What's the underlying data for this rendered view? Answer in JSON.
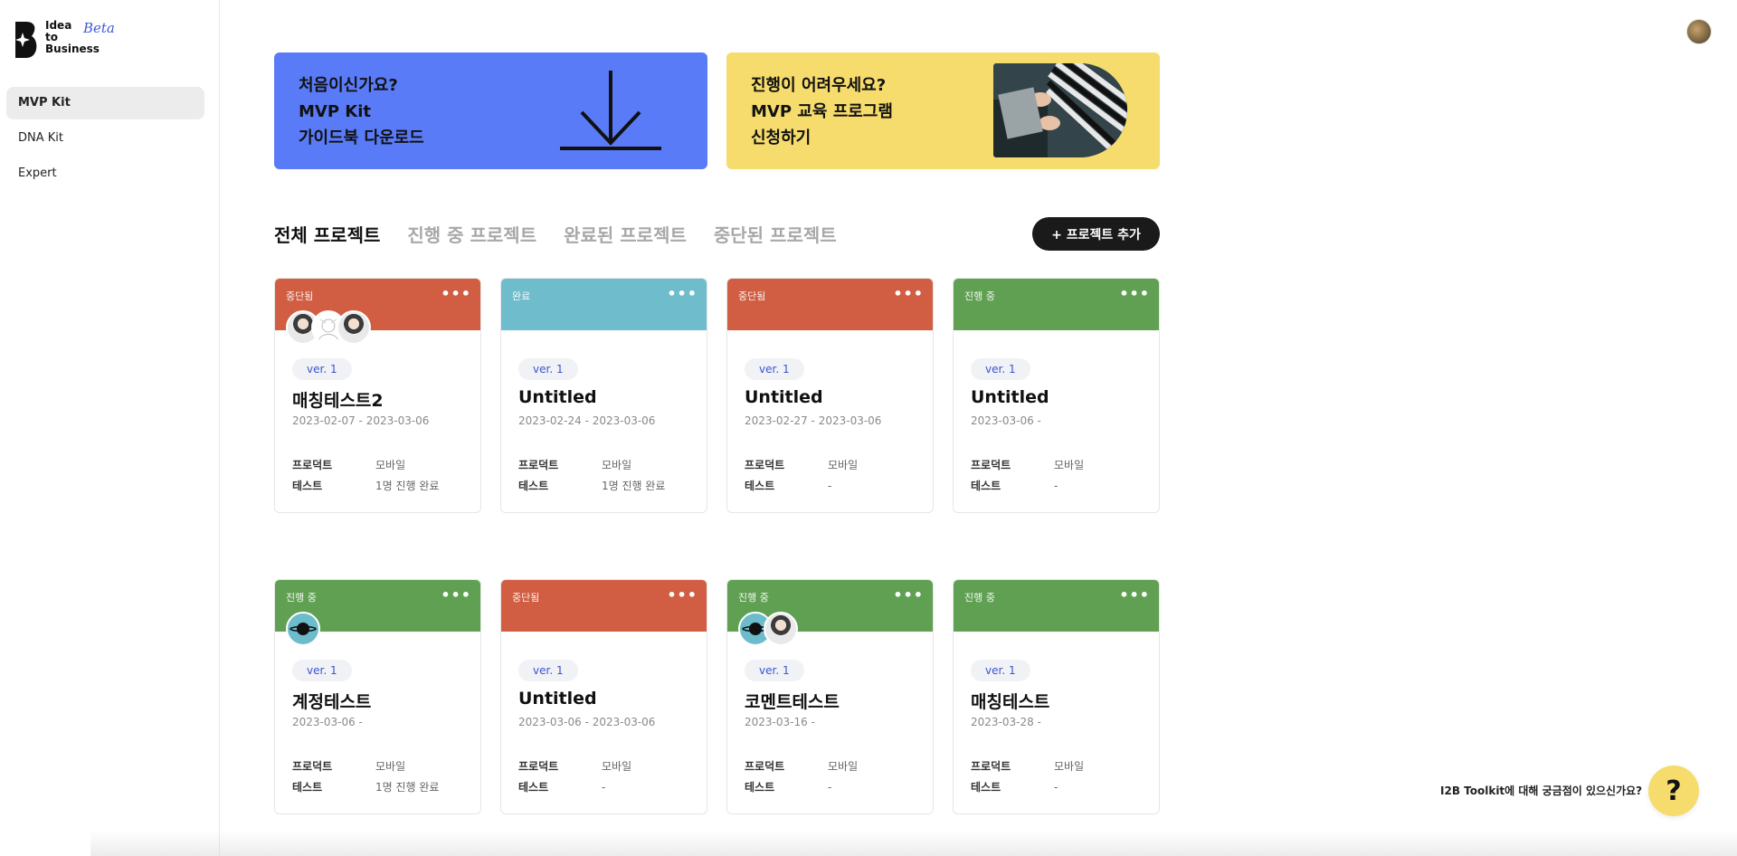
{
  "logo": {
    "line1": "Idea",
    "line2": "to",
    "line3": "Business",
    "beta": "Beta"
  },
  "sidebar": {
    "items": [
      {
        "label": "MVP Kit",
        "active": true
      },
      {
        "label": "DNA Kit",
        "active": false
      },
      {
        "label": "Expert",
        "active": false
      }
    ]
  },
  "banners": {
    "guide": {
      "text": "처음이신가요?\nMVP Kit\n가이드북 다운로드",
      "icon": "download-icon"
    },
    "edu": {
      "text": "진행이 어려우세요?\nMVP 교육 프로그램\n신청하기"
    }
  },
  "tabs": [
    {
      "label": "전체 프로젝트",
      "active": true
    },
    {
      "label": "진행 중 프로젝트",
      "active": false
    },
    {
      "label": "완료된 프로젝트",
      "active": false
    },
    {
      "label": "중단된 프로젝트",
      "active": false
    }
  ],
  "add_button": "+ 프로젝트 추가",
  "colors": {
    "stopped": "#d15d42",
    "done": "#6fbdcc",
    "progress": "#60a053",
    "accent": "#5a7bf7",
    "yellow": "#f6dc6c"
  },
  "meta_labels": {
    "product": "프로덕트",
    "test": "테스트"
  },
  "cards": [
    {
      "status": "중단됨",
      "kind": "stopped",
      "ver": "ver. 1",
      "title": "매칭테스트2",
      "date": "2023-02-07 - 2023-03-06",
      "product": "모바일",
      "test": "1명 진행 완료",
      "avatars": [
        "person",
        "sketch",
        "person"
      ]
    },
    {
      "status": "완료",
      "kind": "done",
      "ver": "ver. 1",
      "title": "Untitled",
      "date": "2023-02-24 - 2023-03-06",
      "product": "모바일",
      "test": "1명 진행 완료",
      "avatars": []
    },
    {
      "status": "중단됨",
      "kind": "stopped",
      "ver": "ver. 1",
      "title": "Untitled",
      "date": "2023-02-27 - 2023-03-06",
      "product": "모바일",
      "test": "-",
      "avatars": []
    },
    {
      "status": "진행 중",
      "kind": "progress",
      "ver": "ver. 1",
      "title": "Untitled",
      "date": "2023-03-06 -",
      "product": "모바일",
      "test": "-",
      "avatars": []
    },
    {
      "status": "진행 중",
      "kind": "progress",
      "ver": "ver. 1",
      "title": "계정테스트",
      "date": "2023-03-06 -",
      "product": "모바일",
      "test": "1명 진행 완료",
      "avatars": [
        "planet"
      ]
    },
    {
      "status": "중단됨",
      "kind": "stopped",
      "ver": "ver. 1",
      "title": "Untitled",
      "date": "2023-03-06 - 2023-03-06",
      "product": "모바일",
      "test": "-",
      "avatars": []
    },
    {
      "status": "진행 중",
      "kind": "progress",
      "ver": "ver. 1",
      "title": "코멘트테스트",
      "date": "2023-03-16 -",
      "product": "모바일",
      "test": "-",
      "avatars": [
        "planet",
        "person"
      ]
    },
    {
      "status": "진행 중",
      "kind": "progress",
      "ver": "ver. 1",
      "title": "매칭테스트",
      "date": "2023-03-28 -",
      "product": "모바일",
      "test": "-",
      "avatars": []
    }
  ],
  "help": {
    "text": "I2B Toolkit에 대해 궁금점이 있으신가요?",
    "button": "?"
  }
}
